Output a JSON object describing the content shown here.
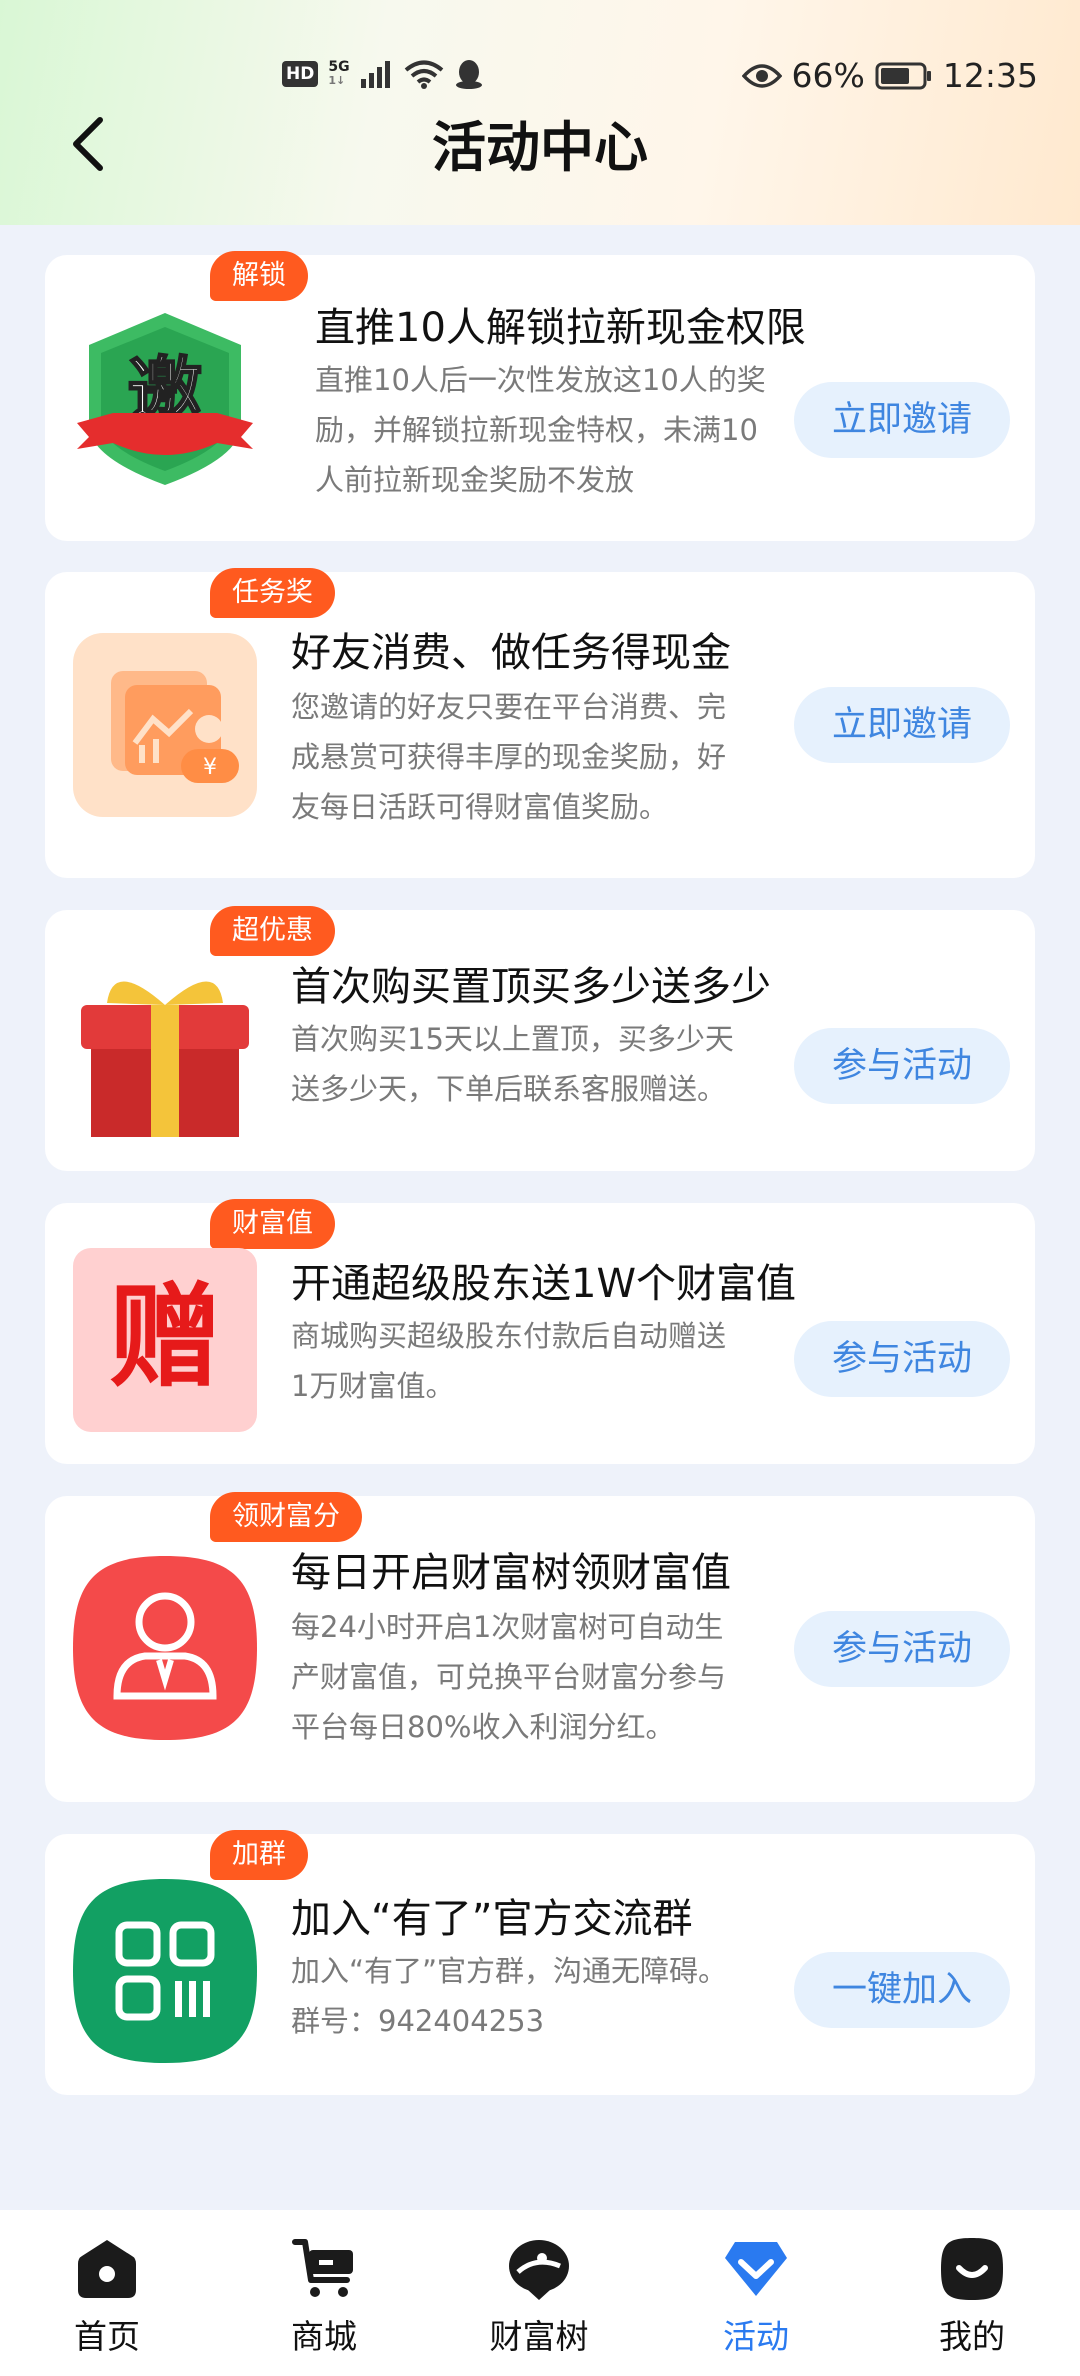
{
  "status_bar": {
    "battery_percent": "66%",
    "time": "12:35",
    "hd": "HD",
    "net": "5G",
    "net_sub": "1↓"
  },
  "header": {
    "title": "活动中心"
  },
  "cards": [
    {
      "tag": "解锁",
      "title": "直推10人解锁拉新现金权限",
      "desc": "直推10人后一次性发放这10人的奖励，并解锁拉新现金特权，未满10人前拉新现金奖励不发放",
      "button": "立即邀请",
      "icon": "invite-badge-icon",
      "icon_char": "邀"
    },
    {
      "tag": "任务奖",
      "title": "好友消费、做任务得现金",
      "desc": "您邀请的好友只要在平台消费、完成悬赏可获得丰厚的现金奖励，好友每日活跃可得财富值奖励。",
      "button": "立即邀请",
      "icon": "finance-chart-icon",
      "icon_char": "¥"
    },
    {
      "tag": "超优惠",
      "title": "首次购买置顶买多少送多少",
      "desc": "首次购买15天以上置顶，买多少天送多少天，下单后联系客服赠送。",
      "button": "参与活动",
      "icon": "gift-box-icon"
    },
    {
      "tag": "财富值",
      "title": "开通超级股东送1W个财富值",
      "desc": "商城购买超级股东付款后自动赠送1万财富值。",
      "button": "参与活动",
      "icon": "gift-text-icon",
      "icon_char": "赠"
    },
    {
      "tag": "领财富分",
      "title": "每日开启财富树领财富值",
      "desc": "每24小时开启1次财富树可自动生产财富值，可兑换平台财富分参与平台每日80%收入利润分红。",
      "button": "参与活动",
      "icon": "user-tie-icon"
    },
    {
      "tag": "加群",
      "title": "加入“有了”官方交流群",
      "desc": "加入“有了”官方群，沟通无障碍。群号：942404253",
      "button": "一键加入",
      "icon": "qr-code-icon"
    }
  ],
  "tabbar": {
    "items": [
      {
        "label": "首页",
        "icon": "home-icon"
      },
      {
        "label": "商城",
        "icon": "cart-icon"
      },
      {
        "label": "财富树",
        "icon": "wealth-tree-icon"
      },
      {
        "label": "活动",
        "icon": "activity-icon",
        "active": true
      },
      {
        "label": "我的",
        "icon": "profile-icon"
      }
    ]
  },
  "colors": {
    "accent": "#2a7af0",
    "tag": "#ff5a1f",
    "button_bg": "#e6f1fd",
    "button_text": "#3f86e0"
  }
}
